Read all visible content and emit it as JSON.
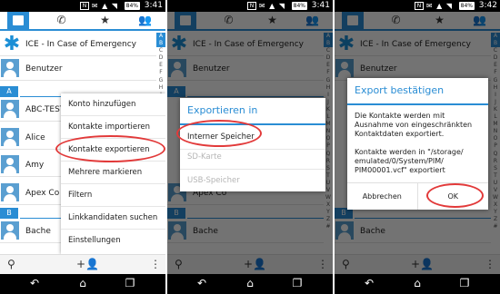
{
  "status": {
    "screen1_time": "3:41",
    "screen2_time": "3:41",
    "screen3_time": "3:42",
    "battery": "84%",
    "nfc": "N"
  },
  "tabs": [
    "person-icon",
    "phone-icon",
    "star-icon",
    "group-icon"
  ],
  "contacts": {
    "ice": "ICE - In Case of Emergency",
    "benutzer": "Benutzer",
    "abc_test": "ABC-TEST",
    "alice": "Alice",
    "amy": "Amy",
    "apex": "Apex Co",
    "bache": "Bache"
  },
  "section_letters": {
    "a": "A",
    "b": "B"
  },
  "index_letters": [
    "A",
    "B",
    "C",
    "D",
    "E",
    "F",
    "G",
    "H",
    "I",
    "J",
    "K",
    "L",
    "M",
    "N",
    "O",
    "P",
    "Q",
    "R",
    "S",
    "T",
    "U",
    "V",
    "W",
    "X",
    "Y",
    "Z",
    "#"
  ],
  "menu": {
    "items": [
      "Konto hinzufügen",
      "Kontakte importieren",
      "Kontakte exportieren",
      "Mehrere markieren",
      "Filtern",
      "Linkkandidaten suchen",
      "Einstellungen"
    ]
  },
  "export_dialog": {
    "title": "Exportieren in",
    "options": [
      "Interner Speicher",
      "SD-Karte",
      "USB-Speicher"
    ]
  },
  "confirm_dialog": {
    "title": "Export bestätigen",
    "message1": "Die Kontakte werden mit Ausnahme von eingeschränkten Kontaktdaten exportiert.",
    "message2": "Kontakte werden in \"/storage/ emulated/0/System/PIM/ PIM00001.vcf\" exportiert",
    "cancel": "Abbrechen",
    "ok": "OK"
  },
  "colors": {
    "accent": "#2a8dd4",
    "highlight": "#e23a3a"
  }
}
